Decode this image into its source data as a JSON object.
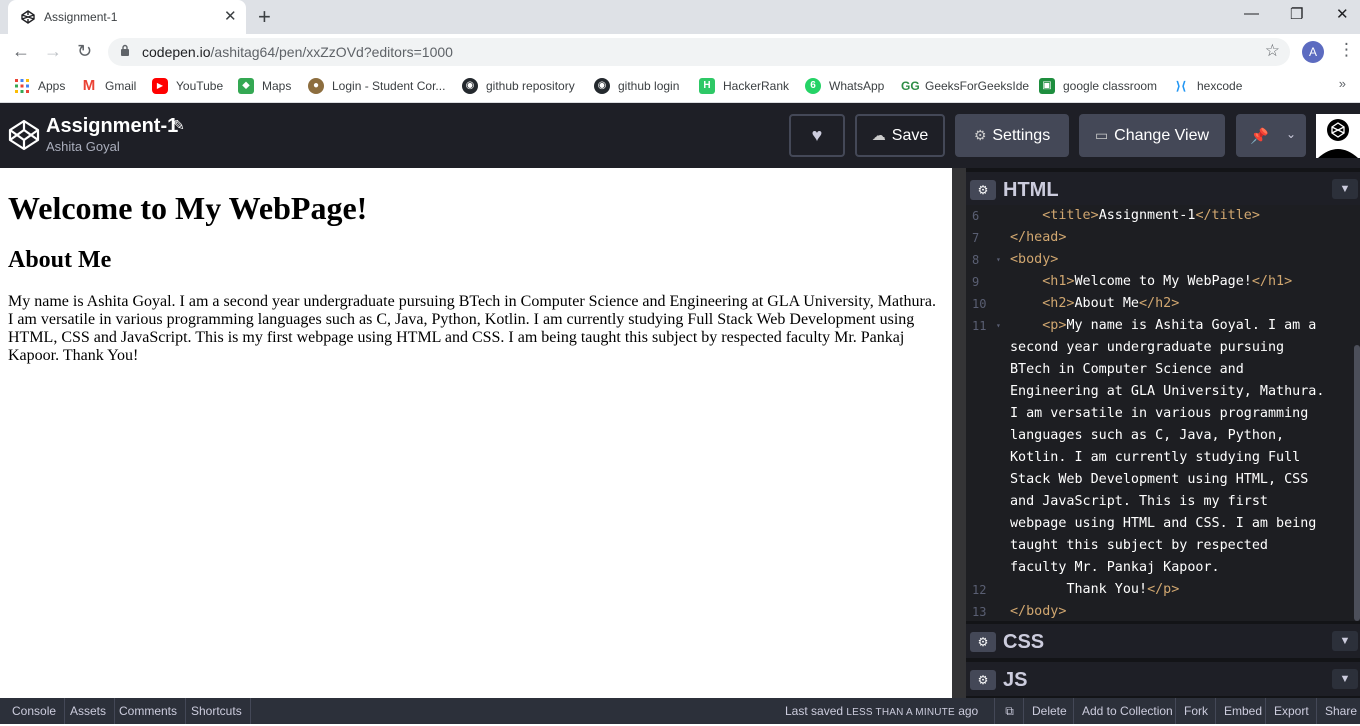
{
  "browser": {
    "tab_title": "Assignment-1",
    "tab_close": "✕",
    "new_tab": "+",
    "win_minimize": "—",
    "win_restore": "❐",
    "win_close": "✕",
    "url_host": "codepen.io",
    "url_path": "/ashitag64/pen/xxZzOVd?editors=1000",
    "profile_initial": "A",
    "bookmarks": [
      {
        "label": "Apps",
        "icon": "apps-grid-icon",
        "color": "#ea4335"
      },
      {
        "label": "Gmail",
        "icon": "gmail-icon",
        "color": "#ea4335"
      },
      {
        "label": "YouTube",
        "icon": "youtube-icon",
        "color": "#ff0000"
      },
      {
        "label": "Maps",
        "icon": "maps-icon",
        "color": "#34a853"
      },
      {
        "label": "Login - Student Cor...",
        "icon": "frog-icon",
        "color": "#8d6e3f"
      },
      {
        "label": "github repository",
        "icon": "github-icon",
        "color": "#24292e"
      },
      {
        "label": "github login",
        "icon": "github-icon",
        "color": "#24292e"
      },
      {
        "label": "HackerRank",
        "icon": "hackerrank-icon",
        "color": "#2ec866"
      },
      {
        "label": "WhatsApp",
        "icon": "whatsapp-icon",
        "color": "#25d366"
      },
      {
        "label": "GeeksForGeeksIde",
        "icon": "gfg-icon",
        "color": "#2f8d46"
      },
      {
        "label": "google classroom",
        "icon": "classroom-icon",
        "color": "#1e8e3e"
      },
      {
        "label": "hexcode",
        "icon": "hexcode-icon",
        "color": "#2196f3"
      }
    ]
  },
  "codepen": {
    "pen_title": "Assignment-1",
    "author": "Ashita Goyal",
    "buttons": {
      "save": "Save",
      "settings": "Settings",
      "change_view": "Change View"
    },
    "accent": "#1e1f26"
  },
  "preview": {
    "h1": "Welcome to My WebPage!",
    "h2": "About Me",
    "p": "My name is Ashita Goyal. I am a second year undergraduate pursuing BTech in Computer Science and Engineering at GLA University, Mathura. I am versatile in various programming languages such as C, Java, Python, Kotlin. I am currently studying Full Stack Web Development using HTML, CSS and JavaScript. This is my first webpage using HTML and CSS. I am being taught this subject by respected faculty Mr. Pankaj Kapoor. Thank You!"
  },
  "editors": {
    "html_label": "HTML",
    "css_label": "CSS",
    "js_label": "JS",
    "code_lines": [
      {
        "n": "6",
        "fold": "",
        "indent": "    ",
        "parts": [
          [
            "tag",
            "<title>"
          ],
          [
            "txt",
            "Assignment-1"
          ],
          [
            "tag",
            "</title>"
          ]
        ]
      },
      {
        "n": "7",
        "fold": "",
        "indent": "",
        "parts": [
          [
            "tag",
            "</head>"
          ]
        ]
      },
      {
        "n": "8",
        "fold": "▾",
        "indent": "",
        "parts": [
          [
            "tag",
            "<body>"
          ]
        ]
      },
      {
        "n": "9",
        "fold": "",
        "indent": "    ",
        "parts": [
          [
            "tag",
            "<h1>"
          ],
          [
            "txt",
            "Welcome to My WebPage!"
          ],
          [
            "tag",
            "</h1>"
          ]
        ]
      },
      {
        "n": "10",
        "fold": "",
        "indent": "    ",
        "parts": [
          [
            "tag",
            "<h2>"
          ],
          [
            "txt",
            "About Me"
          ],
          [
            "tag",
            "</h2>"
          ]
        ]
      },
      {
        "n": "11",
        "fold": "▾",
        "indent": "    ",
        "parts": [
          [
            "tag",
            "<p>"
          ],
          [
            "txt",
            "My name is Ashita Goyal. I am a"
          ]
        ]
      },
      {
        "n": "",
        "fold": "",
        "indent": "",
        "parts": [
          [
            "txt",
            "second year undergraduate pursuing"
          ]
        ]
      },
      {
        "n": "",
        "fold": "",
        "indent": "",
        "parts": [
          [
            "txt",
            "BTech in Computer Science and"
          ]
        ]
      },
      {
        "n": "",
        "fold": "",
        "indent": "",
        "parts": [
          [
            "txt",
            "Engineering at GLA University, Mathura."
          ]
        ]
      },
      {
        "n": "",
        "fold": "",
        "indent": "",
        "parts": [
          [
            "txt",
            "I am versatile in various programming"
          ]
        ]
      },
      {
        "n": "",
        "fold": "",
        "indent": "",
        "parts": [
          [
            "txt",
            "languages such as C, Java, Python,"
          ]
        ]
      },
      {
        "n": "",
        "fold": "",
        "indent": "",
        "parts": [
          [
            "txt",
            "Kotlin. I am currently studying Full"
          ]
        ]
      },
      {
        "n": "",
        "fold": "",
        "indent": "",
        "parts": [
          [
            "txt",
            "Stack Web Development using HTML, CSS"
          ]
        ]
      },
      {
        "n": "",
        "fold": "",
        "indent": "",
        "parts": [
          [
            "txt",
            "and JavaScript. This is my first"
          ]
        ]
      },
      {
        "n": "",
        "fold": "",
        "indent": "",
        "parts": [
          [
            "txt",
            "webpage using HTML and CSS. I am being"
          ]
        ]
      },
      {
        "n": "",
        "fold": "",
        "indent": "",
        "parts": [
          [
            "txt",
            "taught this subject by respected"
          ]
        ]
      },
      {
        "n": "",
        "fold": "",
        "indent": "",
        "parts": [
          [
            "txt",
            "faculty Mr. Pankaj Kapoor."
          ]
        ]
      },
      {
        "n": "12",
        "fold": "",
        "indent": "       ",
        "parts": [
          [
            "txt",
            "Thank You!"
          ],
          [
            "tag",
            "</p>"
          ]
        ]
      },
      {
        "n": "13",
        "fold": "",
        "indent": "",
        "parts": [
          [
            "tag",
            "</body>"
          ]
        ]
      }
    ]
  },
  "footer": {
    "left": [
      "Console",
      "Assets",
      "Comments",
      "Shortcuts"
    ],
    "saved_prefix": "Last saved",
    "saved_when": "LESS THAN A MINUTE",
    "saved_suffix": "ago",
    "right": [
      "Delete",
      "Add to Collection",
      "Fork",
      "Embed",
      "Export",
      "Share"
    ]
  }
}
